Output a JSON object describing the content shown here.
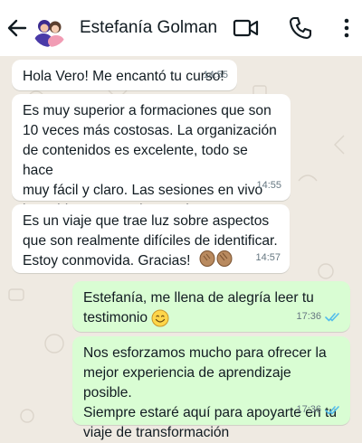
{
  "header": {
    "contact_name": "Estefanía Golman"
  },
  "colors": {
    "incoming_bubble": "#ffffff",
    "outgoing_bubble": "#d9fdd3",
    "read_ticks": "#53bdeb",
    "timestamp": "#667781",
    "chat_background": "#efeae2"
  },
  "icons": {
    "back": "arrow-left-icon",
    "avatar": "avatar-illustration",
    "video": "video-camera-icon",
    "call": "phone-icon",
    "menu": "more-vertical-icon",
    "smile": "smiling-face-emoji",
    "clap": "clapping-hands-emoji",
    "read": "double-check-icon"
  },
  "messages": [
    {
      "direction": "in",
      "text": "Hola Vero! Me encantó tu curso!",
      "time": "14:55"
    },
    {
      "direction": "in",
      "text": "Es muy superior a formaciones que son\n10 veces más costosas. La organización\nde contenidos es excelente, todo se hace\nmuy fácil y claro. Las sesiones en vivo\nhan sido super enriquecedoras!",
      "time": "14:55"
    },
    {
      "direction": "in",
      "text": "Es un viaje que trae luz sobre aspectos\nque son realmente difíciles de identificar.\nEstoy conmovida. Gracias!",
      "time": "14:57"
    },
    {
      "direction": "out",
      "text": "Estefanía, me llena de alegría leer tu\ntestimonio",
      "time": "17:36",
      "status": "read"
    },
    {
      "direction": "out",
      "text": "Nos esforzamos mucho para ofrecer la\nmejor experiencia de aprendizaje posible.\nSiempre estaré aquí para apoyarte en tu\nviaje de transformación",
      "time": "17:36",
      "status": "read"
    }
  ]
}
